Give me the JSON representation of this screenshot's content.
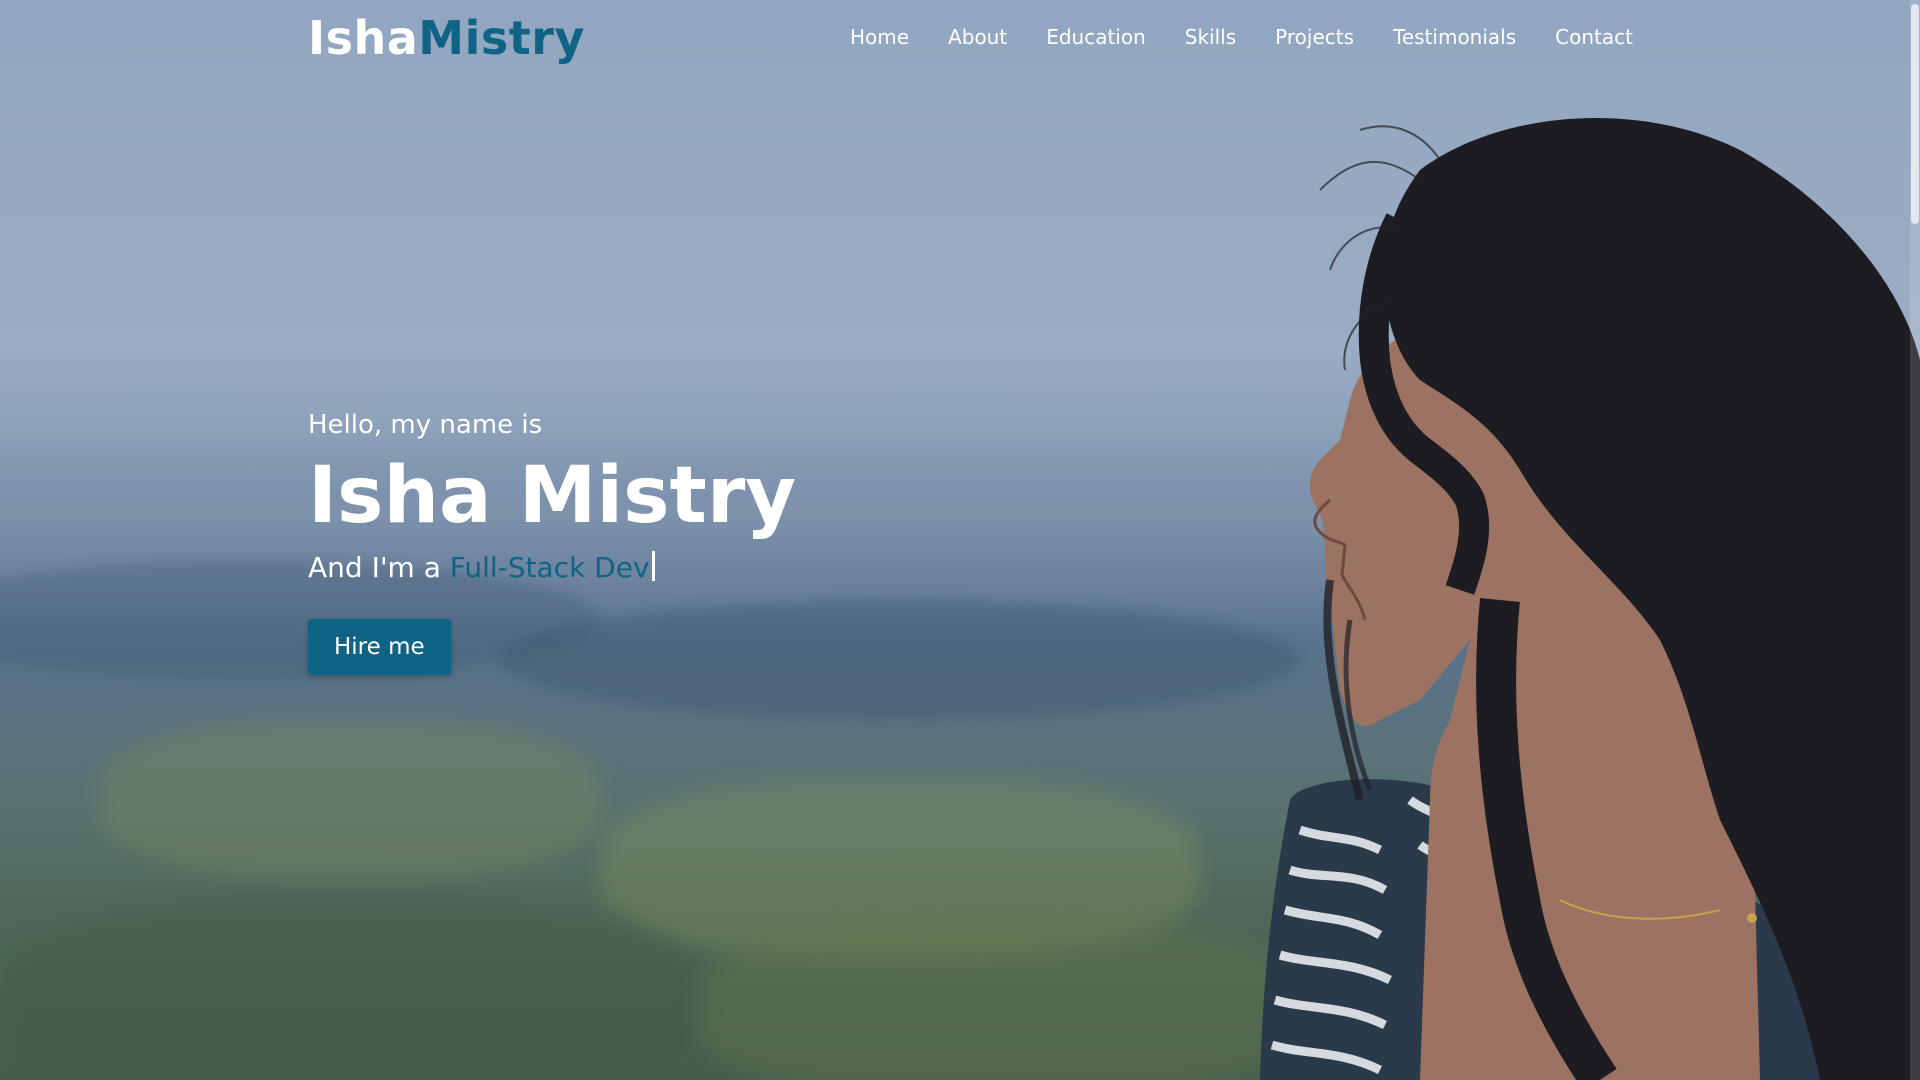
{
  "brand": {
    "first": "Isha",
    "last": "Mistry"
  },
  "nav": {
    "items": [
      {
        "label": "Home"
      },
      {
        "label": "About"
      },
      {
        "label": "Education"
      },
      {
        "label": "Skills"
      },
      {
        "label": "Projects"
      },
      {
        "label": "Testimonials"
      },
      {
        "label": "Contact"
      }
    ]
  },
  "hero": {
    "greeting": "Hello, my name is",
    "name": "Isha Mistry",
    "role_prefix": "And I'm a",
    "role": "Full-Stack Dev",
    "cta_label": "Hire me"
  },
  "colors": {
    "accent": "#0f6385",
    "text": "#ffffff"
  }
}
